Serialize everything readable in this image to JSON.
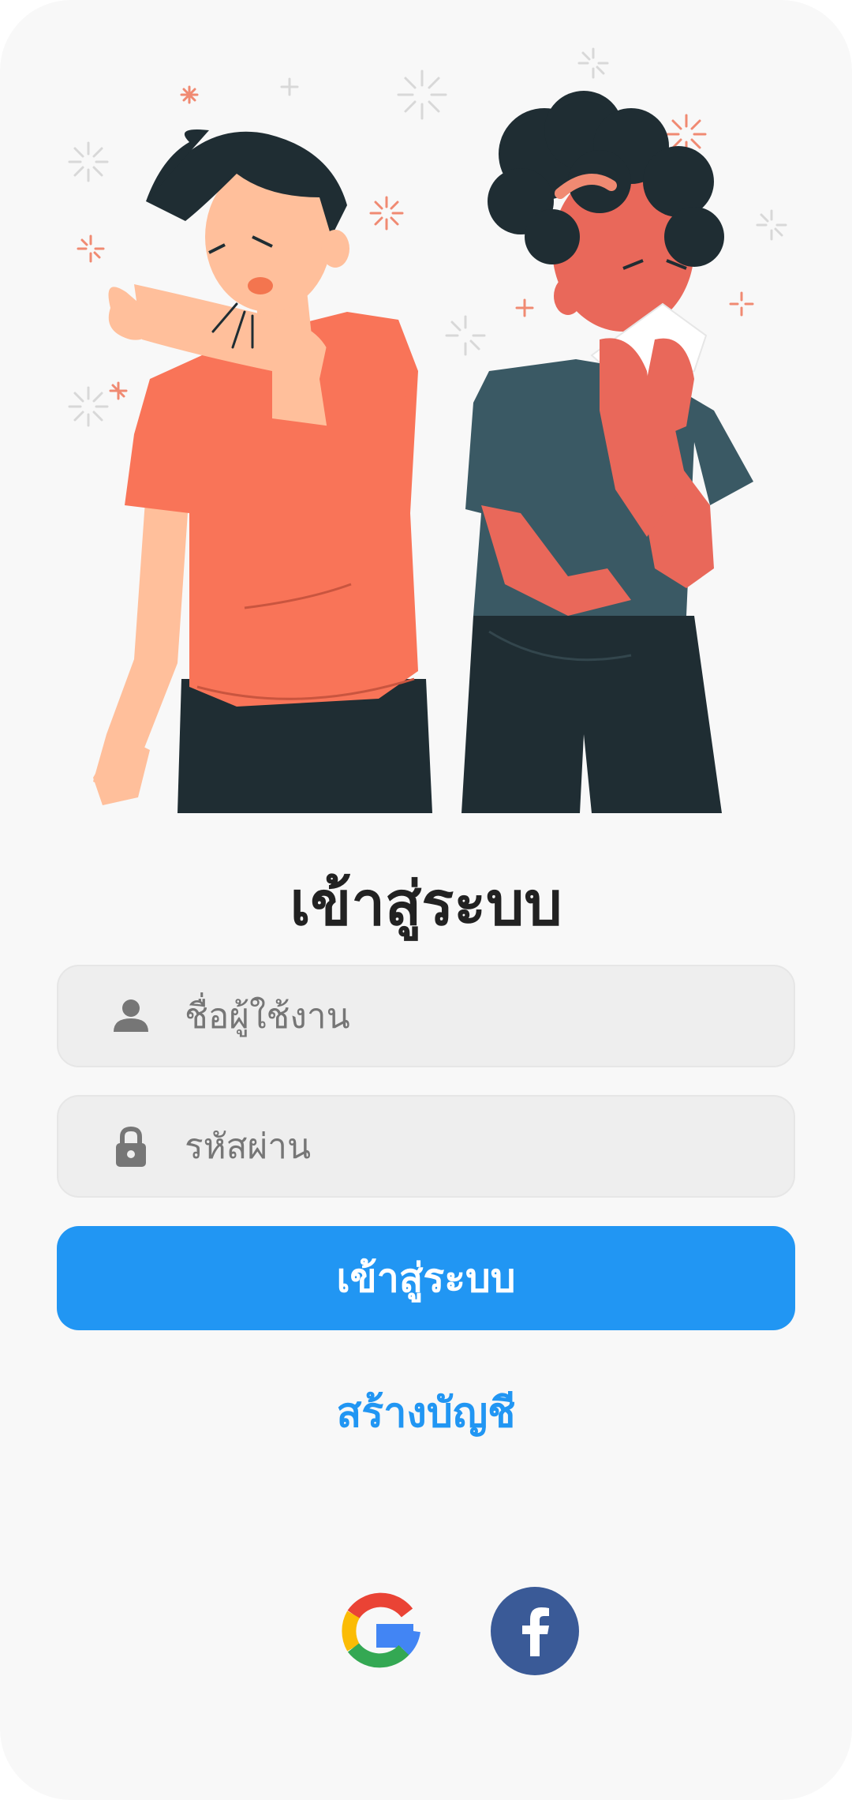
{
  "login": {
    "title": "เข้าสู่ระบบ",
    "username_placeholder": "ชื่อผู้ใช้งาน",
    "password_placeholder": "รหัสผ่าน",
    "submit_label": "เข้าสู่ระบบ",
    "create_account_label": "สร้างบัญชี"
  },
  "illustration": {
    "name": "people-coughing-sneezing-illustration"
  },
  "social": [
    {
      "icon": "google-icon"
    },
    {
      "icon": "facebook-icon"
    }
  ],
  "colors": {
    "background": "#f8f8f8",
    "primary": "#2196f3",
    "field_background": "#eeeeee",
    "icon_gray": "#767676",
    "facebook": "#3a5a97",
    "title": "#222222"
  }
}
